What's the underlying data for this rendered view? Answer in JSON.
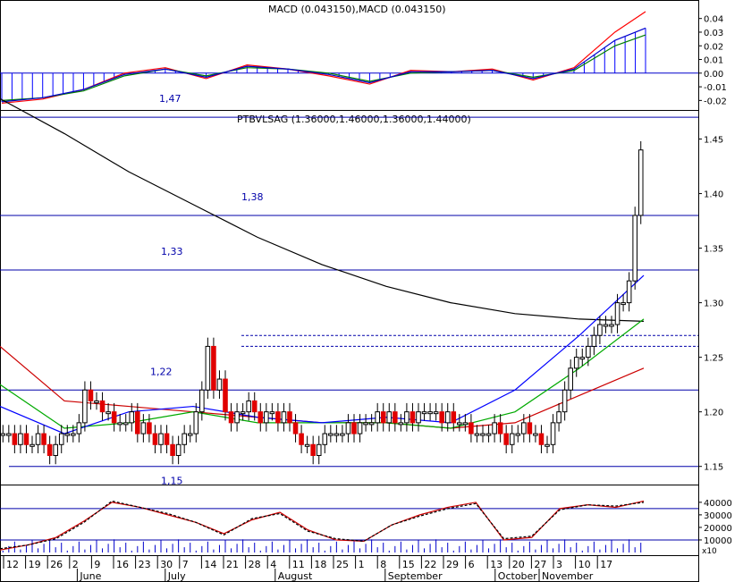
{
  "chart_data": [
    {
      "type": "line",
      "panel": "macd",
      "title": "MACD (0.043150),MACD (0.043150)",
      "y_ticks": [
        "0.04",
        "0.03",
        "0.02",
        "0.01",
        "0.00",
        "-0.01",
        "-0.02"
      ],
      "ylim": [
        -0.025,
        0.047
      ],
      "baseline": 0.0,
      "series": [
        {
          "color": "#ff0000",
          "x": [
            0,
            8,
            16,
            24,
            32,
            40,
            48,
            56,
            64,
            72,
            80,
            88,
            96,
            104,
            112,
            120,
            126
          ],
          "values": [
            -0.022,
            -0.019,
            -0.012,
            0.0,
            0.004,
            -0.004,
            0.006,
            0.003,
            -0.002,
            -0.008,
            0.002,
            0.001,
            0.003,
            -0.005,
            0.004,
            0.03,
            0.045
          ]
        },
        {
          "color": "#008000",
          "x": [
            0,
            8,
            16,
            24,
            32,
            40,
            48,
            56,
            64,
            72,
            80,
            88,
            96,
            104,
            112,
            120,
            126
          ],
          "values": [
            -0.02,
            -0.018,
            -0.013,
            -0.002,
            0.003,
            -0.002,
            0.004,
            0.003,
            0.0,
            -0.006,
            0.0,
            0.001,
            0.002,
            -0.003,
            0.002,
            0.02,
            0.028
          ]
        },
        {
          "color": "#0000cc",
          "x": [
            0,
            8,
            16,
            24,
            32,
            40,
            48,
            56,
            64,
            72,
            80,
            88,
            96,
            104,
            112,
            120,
            126
          ],
          "values": [
            -0.021,
            -0.018,
            -0.012,
            -0.001,
            0.003,
            -0.003,
            0.005,
            0.003,
            -0.001,
            -0.007,
            0.001,
            0.001,
            0.002,
            -0.004,
            0.003,
            0.024,
            0.033
          ]
        }
      ],
      "histogram_color": "#0000ff"
    },
    {
      "type": "candlestick",
      "panel": "price",
      "title": "PTBVLSAG (1.36000,1.46000,1.36000,1.44000)",
      "y_ticks": [
        "1.45",
        "1.40",
        "1.35",
        "1.30",
        "1.25",
        "1.20",
        "1.15"
      ],
      "ylim": [
        1.135,
        1.475
      ],
      "horizontal_levels": [
        {
          "label": "1,47",
          "value": 1.47
        },
        {
          "label": "1,38",
          "value": 1.38
        },
        {
          "label": "1,33",
          "value": 1.33
        },
        {
          "label": "1,22",
          "value": 1.22
        },
        {
          "label": "1,15",
          "value": 1.15
        }
      ],
      "dashed_levels": [
        1.27,
        1.26
      ],
      "candles_close": [
        1.18,
        1.18,
        1.17,
        1.18,
        1.17,
        1.17,
        1.18,
        1.17,
        1.16,
        1.17,
        1.18,
        1.18,
        1.18,
        1.19,
        1.22,
        1.21,
        1.21,
        1.2,
        1.2,
        1.19,
        1.19,
        1.19,
        1.2,
        1.18,
        1.19,
        1.18,
        1.17,
        1.18,
        1.17,
        1.16,
        1.17,
        1.18,
        1.18,
        1.2,
        1.22,
        1.26,
        1.22,
        1.23,
        1.2,
        1.19,
        1.2,
        1.2,
        1.21,
        1.2,
        1.19,
        1.2,
        1.2,
        1.19,
        1.2,
        1.19,
        1.18,
        1.17,
        1.17,
        1.16,
        1.17,
        1.18,
        1.18,
        1.18,
        1.18,
        1.19,
        1.18,
        1.19,
        1.19,
        1.19,
        1.2,
        1.19,
        1.2,
        1.19,
        1.19,
        1.2,
        1.19,
        1.2,
        1.2,
        1.2,
        1.2,
        1.19,
        1.2,
        1.19,
        1.19,
        1.19,
        1.18,
        1.18,
        1.18,
        1.18,
        1.19,
        1.18,
        1.17,
        1.18,
        1.18,
        1.19,
        1.18,
        1.18,
        1.17,
        1.17,
        1.19,
        1.2,
        1.22,
        1.24,
        1.25,
        1.25,
        1.26,
        1.27,
        1.28,
        1.28,
        1.28,
        1.3,
        1.3,
        1.32,
        1.38,
        1.44
      ],
      "moving_averages": [
        {
          "color": "#000000",
          "values": [
            1.487,
            1.455,
            1.42,
            1.39,
            1.36,
            1.335,
            1.315,
            1.3,
            1.29,
            1.285,
            1.283
          ]
        },
        {
          "color": "#cc0000",
          "values": [
            1.26,
            1.21,
            1.205,
            1.2,
            1.195,
            1.19,
            1.19,
            1.185,
            1.19,
            1.215,
            1.24
          ]
        },
        {
          "color": "#00aa00",
          "values": [
            1.225,
            1.185,
            1.19,
            1.2,
            1.19,
            1.19,
            1.19,
            1.185,
            1.2,
            1.24,
            1.285
          ]
        },
        {
          "color": "#0000ff",
          "values": [
            1.205,
            1.18,
            1.2,
            1.205,
            1.195,
            1.19,
            1.195,
            1.19,
            1.22,
            1.27,
            1.325
          ]
        }
      ]
    },
    {
      "type": "line",
      "panel": "volume",
      "y_ticks": [
        "40000",
        "30000",
        "20000",
        "10000"
      ],
      "ylim": [
        0,
        52000
      ],
      "multiplier_label": "x10",
      "horizontal_levels": [
        35000,
        10000
      ],
      "series": [
        {
          "color": "#cc0000",
          "values": [
            2000,
            6000,
            12000,
            25000,
            40000,
            36000,
            30000,
            24000,
            15000,
            26000,
            32000,
            18000,
            10000,
            9000,
            22000,
            30000,
            36000,
            40000,
            10000,
            12000,
            35000,
            38000,
            36000,
            41000
          ]
        },
        {
          "color": "#000000",
          "values": [
            3000,
            6000,
            11000,
            24000,
            41000,
            36000,
            31000,
            24000,
            14000,
            27000,
            31000,
            17000,
            11000,
            9000,
            22000,
            29000,
            35000,
            39000,
            11000,
            13000,
            34000,
            38000,
            37000,
            40000
          ]
        }
      ]
    }
  ],
  "x_axis": {
    "day_ticks": [
      "12",
      "19",
      "26",
      "2",
      "9",
      "16",
      "23",
      "30",
      "7",
      "14",
      "21",
      "28",
      "4",
      "11",
      "18",
      "25",
      "1",
      "8",
      "15",
      "22",
      "29",
      "6",
      "13",
      "20",
      "27",
      "3",
      "10",
      "17"
    ],
    "month_labels": [
      "June",
      "July",
      "August",
      "September",
      "October",
      "November"
    ]
  }
}
